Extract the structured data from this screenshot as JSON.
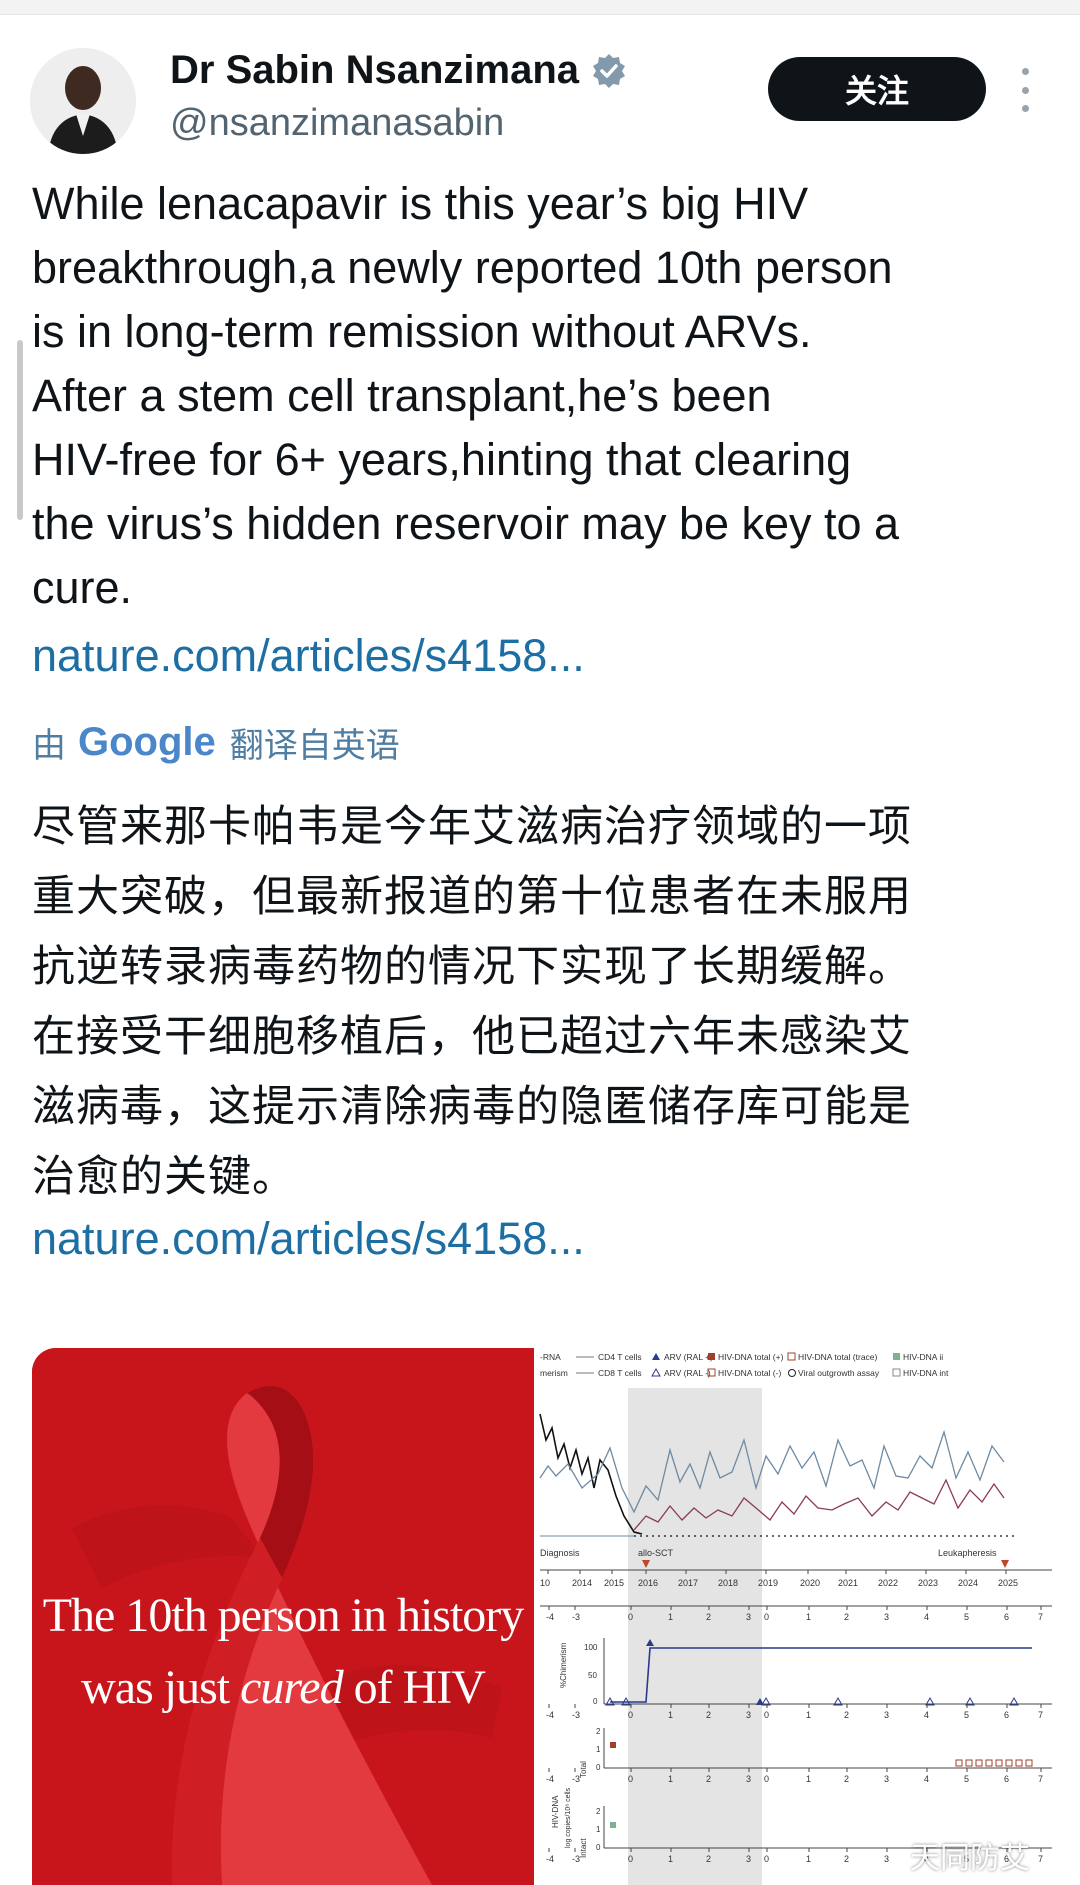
{
  "author": {
    "name": "Dr Sabin Nsanzimana",
    "handle": "@nsanzimanasabin",
    "verified": true,
    "avatar_icon": "person-avatar"
  },
  "actions": {
    "follow_label": "关注"
  },
  "tweet": {
    "text_en": "While lenacapavir is this year’s big HIV\nbreakthrough,a newly reported 10th person\nis in long-term remission without ARVs.\nAfter a stem cell transplant,he’s been\nHIV-free for 6+ years,hinting that clearing\nthe virus’s hidden reservoir may be key to a\ncure.",
    "link_text": "nature.com/articles/s4158...",
    "translation_prefix": "由",
    "translation_brand": "Google",
    "translation_suffix": "翻译自英语",
    "text_zh": "尽管来那卡帕韦是今年艾滋病治疗领域的一项\n重大突破，但最新报道的第十位患者在未服用\n抗逆转录病毒药物的情况下实现了长期缓解。\n在接受干细胞移植后，他已超过六年未感染艾\n滋病毒，这提示清除病毒的隐匿储存库可能是\n治愈的关键。",
    "link_text_2": "nature.com/articles/s4158..."
  },
  "media": {
    "card_line1": "The 10th person in history",
    "card_line2_pre": "was just ",
    "card_line2_em": "cured",
    "card_line2_post": " of HIV",
    "chart": {
      "legend_row1": [
        "-RNA",
        "CD4 T cells",
        "ARV (RAL +)",
        "HIV-DNA total (+)",
        "HIV-DNA total (trace)",
        "HIV-DNA ii"
      ],
      "legend_row2": [
        "merism",
        "CD8 T cells",
        "ARV (RAL -)",
        "HIV-DNA total (-)",
        "Viral outgrowth assay",
        "HIV-DNA int"
      ],
      "events": [
        "Diagnosis",
        "allo-SCT",
        "Leukapheresis"
      ],
      "years": [
        "10",
        "2014",
        "2015",
        "2016",
        "2017",
        "2018",
        "2019",
        "2020",
        "2021",
        "2022",
        "2023",
        "2024",
        "2025"
      ],
      "rel_axis_a": [
        "-4",
        "-3",
        "0",
        "1",
        "2",
        "3",
        "0"
      ],
      "rel_axis_b": [
        "1",
        "2",
        "3",
        "4",
        "5",
        "6",
        "7"
      ],
      "chimerism_label": "%Chimerism",
      "chimerism_ticks": [
        "100",
        "50",
        "0"
      ],
      "total_label": "Total",
      "hivdna_label": "HIV-DNA",
      "log_label": "log copies/10⁶ cells",
      "intact_label": "Intact",
      "panel_ticks_a": [
        "2",
        "1",
        "0"
      ],
      "panel_ticks_b": [
        "2",
        "1",
        "0"
      ]
    },
    "watermark": "天同防艾"
  },
  "colors": {
    "link": "#1d6fa3",
    "card_red": "#c8151c",
    "follow_bg": "#0f1419",
    "verified": "#829aab"
  }
}
